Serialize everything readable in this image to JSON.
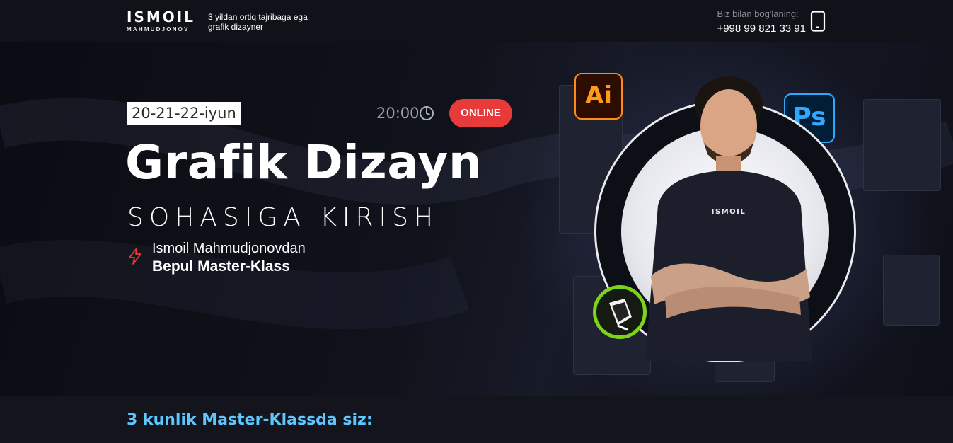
{
  "header": {
    "logo_main": "ISMOIL",
    "logo_sub": "MAHMUDJONOV",
    "tagline": "3 yildan ortiq tajribaga ega grafik dizayner",
    "contact_label": "Biz bilan bog'laning:",
    "contact_phone": "+998 99 821 33 91",
    "phone_icon": "smartphone-icon"
  },
  "hero": {
    "date": "20-21-22-iyun",
    "time": "20:00",
    "clock_icon": "clock-icon",
    "online_badge": "ONLINE",
    "title": "Grafik Dizayn",
    "subtitle": "SOHASIGA KIRISH",
    "author": "Ismoil Mahmudjonovdan",
    "masterclass": "Bepul Master-Klass",
    "bolt_icon": "lightning-icon",
    "app_icons": {
      "illustrator": "Ai",
      "photoshop": "Ps",
      "corel": "coreldraw-pen-icon"
    },
    "shirt_logo": "ISMOIL",
    "colors": {
      "online": "#e73a3a",
      "accent_text": "#5fc7ff",
      "ai_orange": "#ff9a1a",
      "ps_blue": "#31a8ff",
      "corel_green": "#7cd31a"
    }
  },
  "section": {
    "title": "3 kunlik Master-Klassda siz:"
  }
}
